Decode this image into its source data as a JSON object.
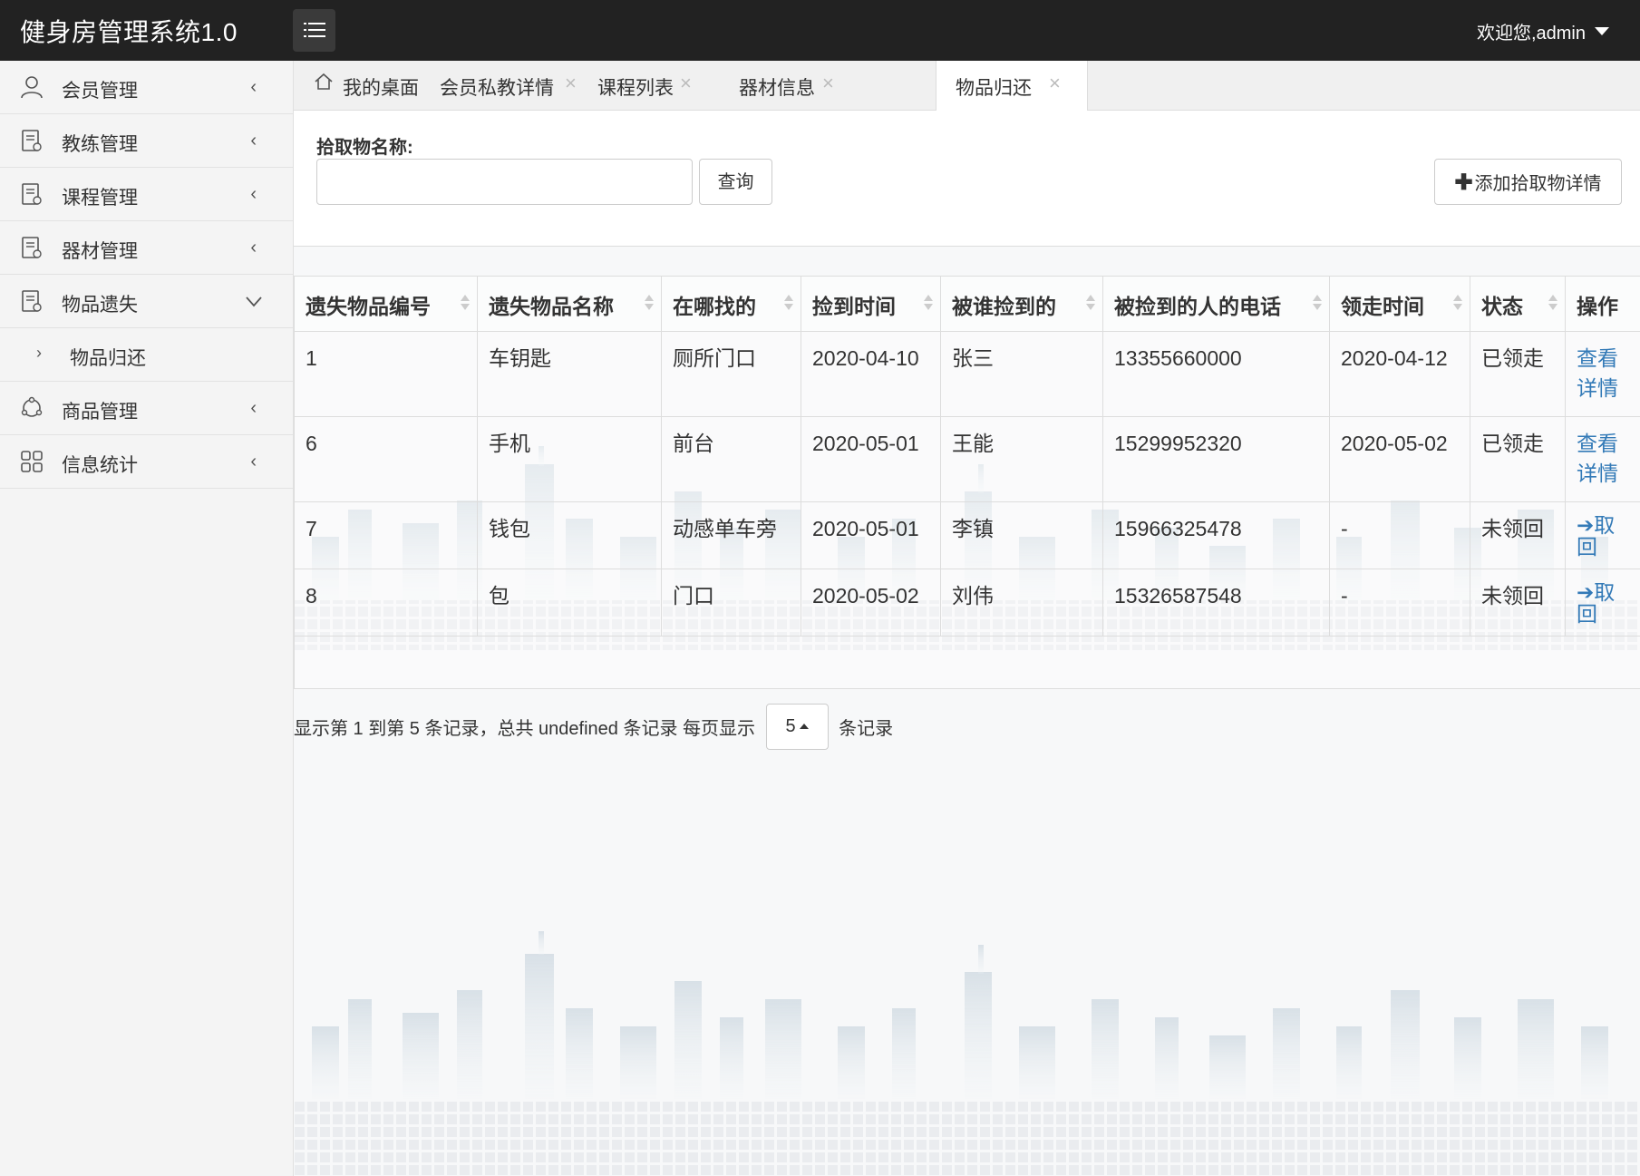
{
  "header": {
    "app_title": "健身房管理系统1.0",
    "welcome_text": "欢迎您,admin"
  },
  "sidebar": {
    "items": [
      {
        "label": "会员管理",
        "icon": "user-icon"
      },
      {
        "label": "教练管理",
        "icon": "document-icon"
      },
      {
        "label": "课程管理",
        "icon": "document-icon"
      },
      {
        "label": "器材管理",
        "icon": "document-icon"
      },
      {
        "label": "物品遗失",
        "icon": "document-icon",
        "expanded": true,
        "children": [
          {
            "label": "物品归还"
          }
        ]
      },
      {
        "label": "商品管理",
        "icon": "cloud-icon"
      },
      {
        "label": "信息统计",
        "icon": "grid-icon"
      }
    ]
  },
  "tabs": [
    {
      "label": "我的桌面",
      "icon": "home-icon",
      "closable": false
    },
    {
      "label": "会员私教详情",
      "closable": true
    },
    {
      "label": "课程列表",
      "closable": true
    },
    {
      "label": "器材信息",
      "closable": true
    },
    {
      "label": "物品归还",
      "closable": true,
      "active": true
    }
  ],
  "search": {
    "label": "拾取物名称:",
    "value": "",
    "query_button": "查询",
    "add_button": "添加拾取物详情"
  },
  "table": {
    "columns": [
      "遗失物品编号",
      "遗失物品名称",
      "在哪找的",
      "捡到时间",
      "被谁捡到的",
      "被捡到的人的电话",
      "领走时间",
      "状态",
      "操作"
    ],
    "rows": [
      {
        "id": "1",
        "name": "车钥匙",
        "where": "厕所门口",
        "found_date": "2020-04-10",
        "finder": "张三",
        "phone": "13355660000",
        "taken_date": "2020-04-12",
        "status": "已领走",
        "action": "查看详情"
      },
      {
        "id": "6",
        "name": "手机",
        "where": "前台",
        "found_date": "2020-05-01",
        "finder": "王能",
        "phone": "15299952320",
        "taken_date": "2020-05-02",
        "status": "已领走",
        "action": "查看详情"
      },
      {
        "id": "7",
        "name": "钱包",
        "where": "动感单车旁",
        "found_date": "2020-05-01",
        "finder": "李镇",
        "phone": "15966325478",
        "taken_date": "-",
        "status": "未领回",
        "action": "取回"
      },
      {
        "id": "8",
        "name": "包",
        "where": "门口",
        "found_date": "2020-05-02",
        "finder": "刘伟",
        "phone": "15326587548",
        "taken_date": "-",
        "status": "未领回",
        "action": "取回"
      }
    ]
  },
  "pagination": {
    "summary": "显示第 1 到第 5 条记录，总共 undefined 条记录 每页显示",
    "page_size": "5",
    "suffix": "条记录"
  },
  "colors": {
    "topbar": "#222222",
    "sidebar": "#f4f4f4",
    "link": "#337ab7"
  }
}
